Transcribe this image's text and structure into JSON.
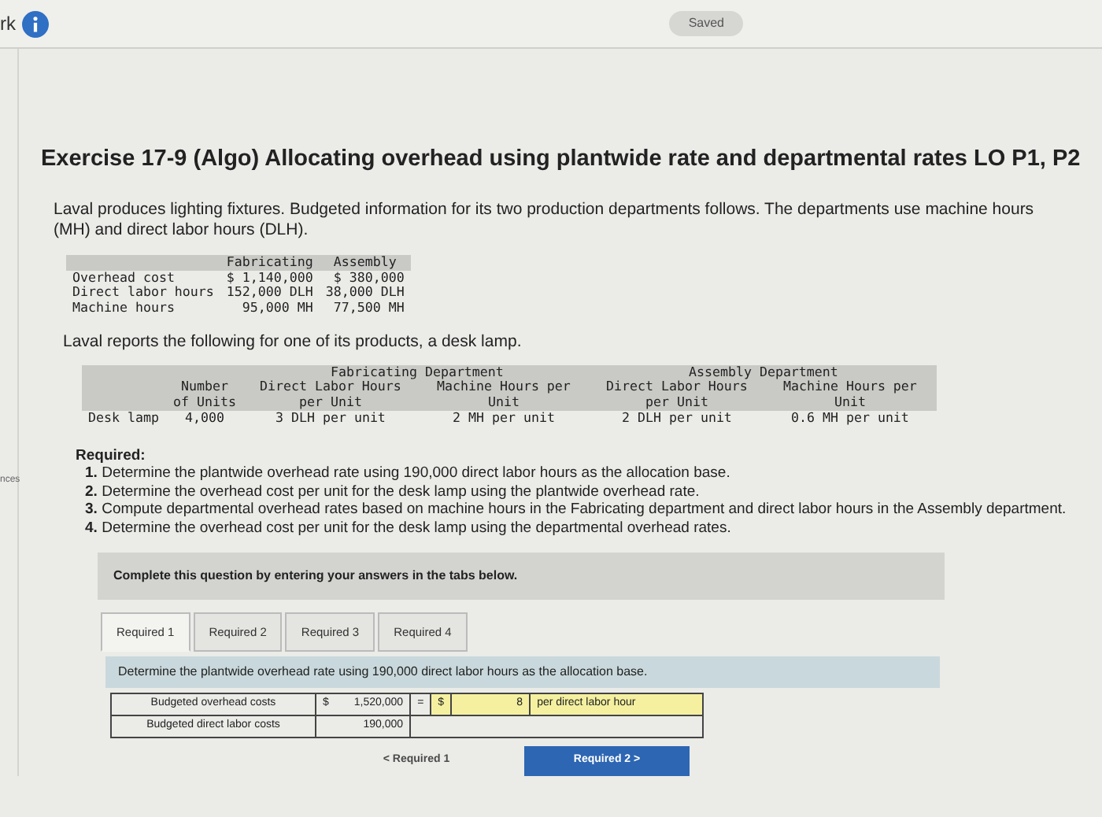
{
  "header": {
    "partial_title": "rk",
    "status": "Saved"
  },
  "sidebar": {
    "label": "nces"
  },
  "exercise": {
    "title": "Exercise 17-9 (Algo) Allocating overhead using plantwide rate and departmental rates LO P1, P2",
    "intro": "Laval produces lighting fixtures. Budgeted information for its two production departments follows. The departments use machine hours (MH) and direct labor hours (DLH).",
    "budget_table": {
      "columns": [
        "",
        "Fabricating",
        "Assembly"
      ],
      "rows": [
        {
          "label": "Overhead cost",
          "values": [
            "$ 1,140,000",
            "$ 380,000"
          ]
        },
        {
          "label": "Direct labor hours",
          "values": [
            "152,000 DLH",
            "38,000 DLH"
          ]
        },
        {
          "label": "Machine hours",
          "values": [
            "95,000 MH",
            "77,500 MH"
          ]
        }
      ]
    },
    "product_intro": "Laval reports the following for one of its products, a desk lamp.",
    "product_table": {
      "groups": [
        "Fabricating Department",
        "Assembly Department"
      ],
      "columns": [
        "",
        "Number of Units",
        "Direct Labor Hours per Unit",
        "Machine Hours per Unit",
        "Direct Labor Hours per Unit",
        "Machine Hours per Unit"
      ],
      "rows": [
        {
          "label": "Desk lamp",
          "values": [
            "4,000",
            "3 DLH per unit",
            "2 MH per unit",
            "2 DLH per unit",
            "0.6 MH per unit"
          ]
        }
      ]
    },
    "required_heading": "Required:",
    "requirements": [
      "**1.** Determine the plantwide overhead rate using 190,000 direct labor hours as the allocation base.",
      "**2.** Determine the overhead cost per unit for the desk lamp using the plantwide overhead rate.",
      "**3.** Compute departmental overhead rates based on machine hours in the Fabricating department and direct labor hours in the Assembly department.",
      "**4.** Determine the overhead cost per unit for the desk lamp using the departmental overhead rates."
    ]
  },
  "answer_panel": {
    "instruction": "Complete this question by entering your answers in the tabs below.",
    "tabs": [
      {
        "label": "Required 1",
        "selected": true
      },
      {
        "label": "Required 2",
        "selected": false
      },
      {
        "label": "Required 3",
        "selected": false
      },
      {
        "label": "Required 4",
        "selected": false
      }
    ],
    "prompt": "Determine the plantwide overhead rate using 190,000 direct labor hours as the allocation base.",
    "calc_rows": [
      {
        "label": "Budgeted overhead costs",
        "currency": "$",
        "value": "1,520,000",
        "operator": "=",
        "result_currency": "$",
        "answer": "8",
        "unit": "per direct labor hour"
      },
      {
        "label": "Budgeted direct labor costs",
        "value": "190,000"
      }
    ],
    "nav": [
      {
        "kind": "prev",
        "label": "< Required 1",
        "disabled": true
      },
      {
        "kind": "next",
        "label": "Required 2 >",
        "disabled": false
      }
    ]
  }
}
